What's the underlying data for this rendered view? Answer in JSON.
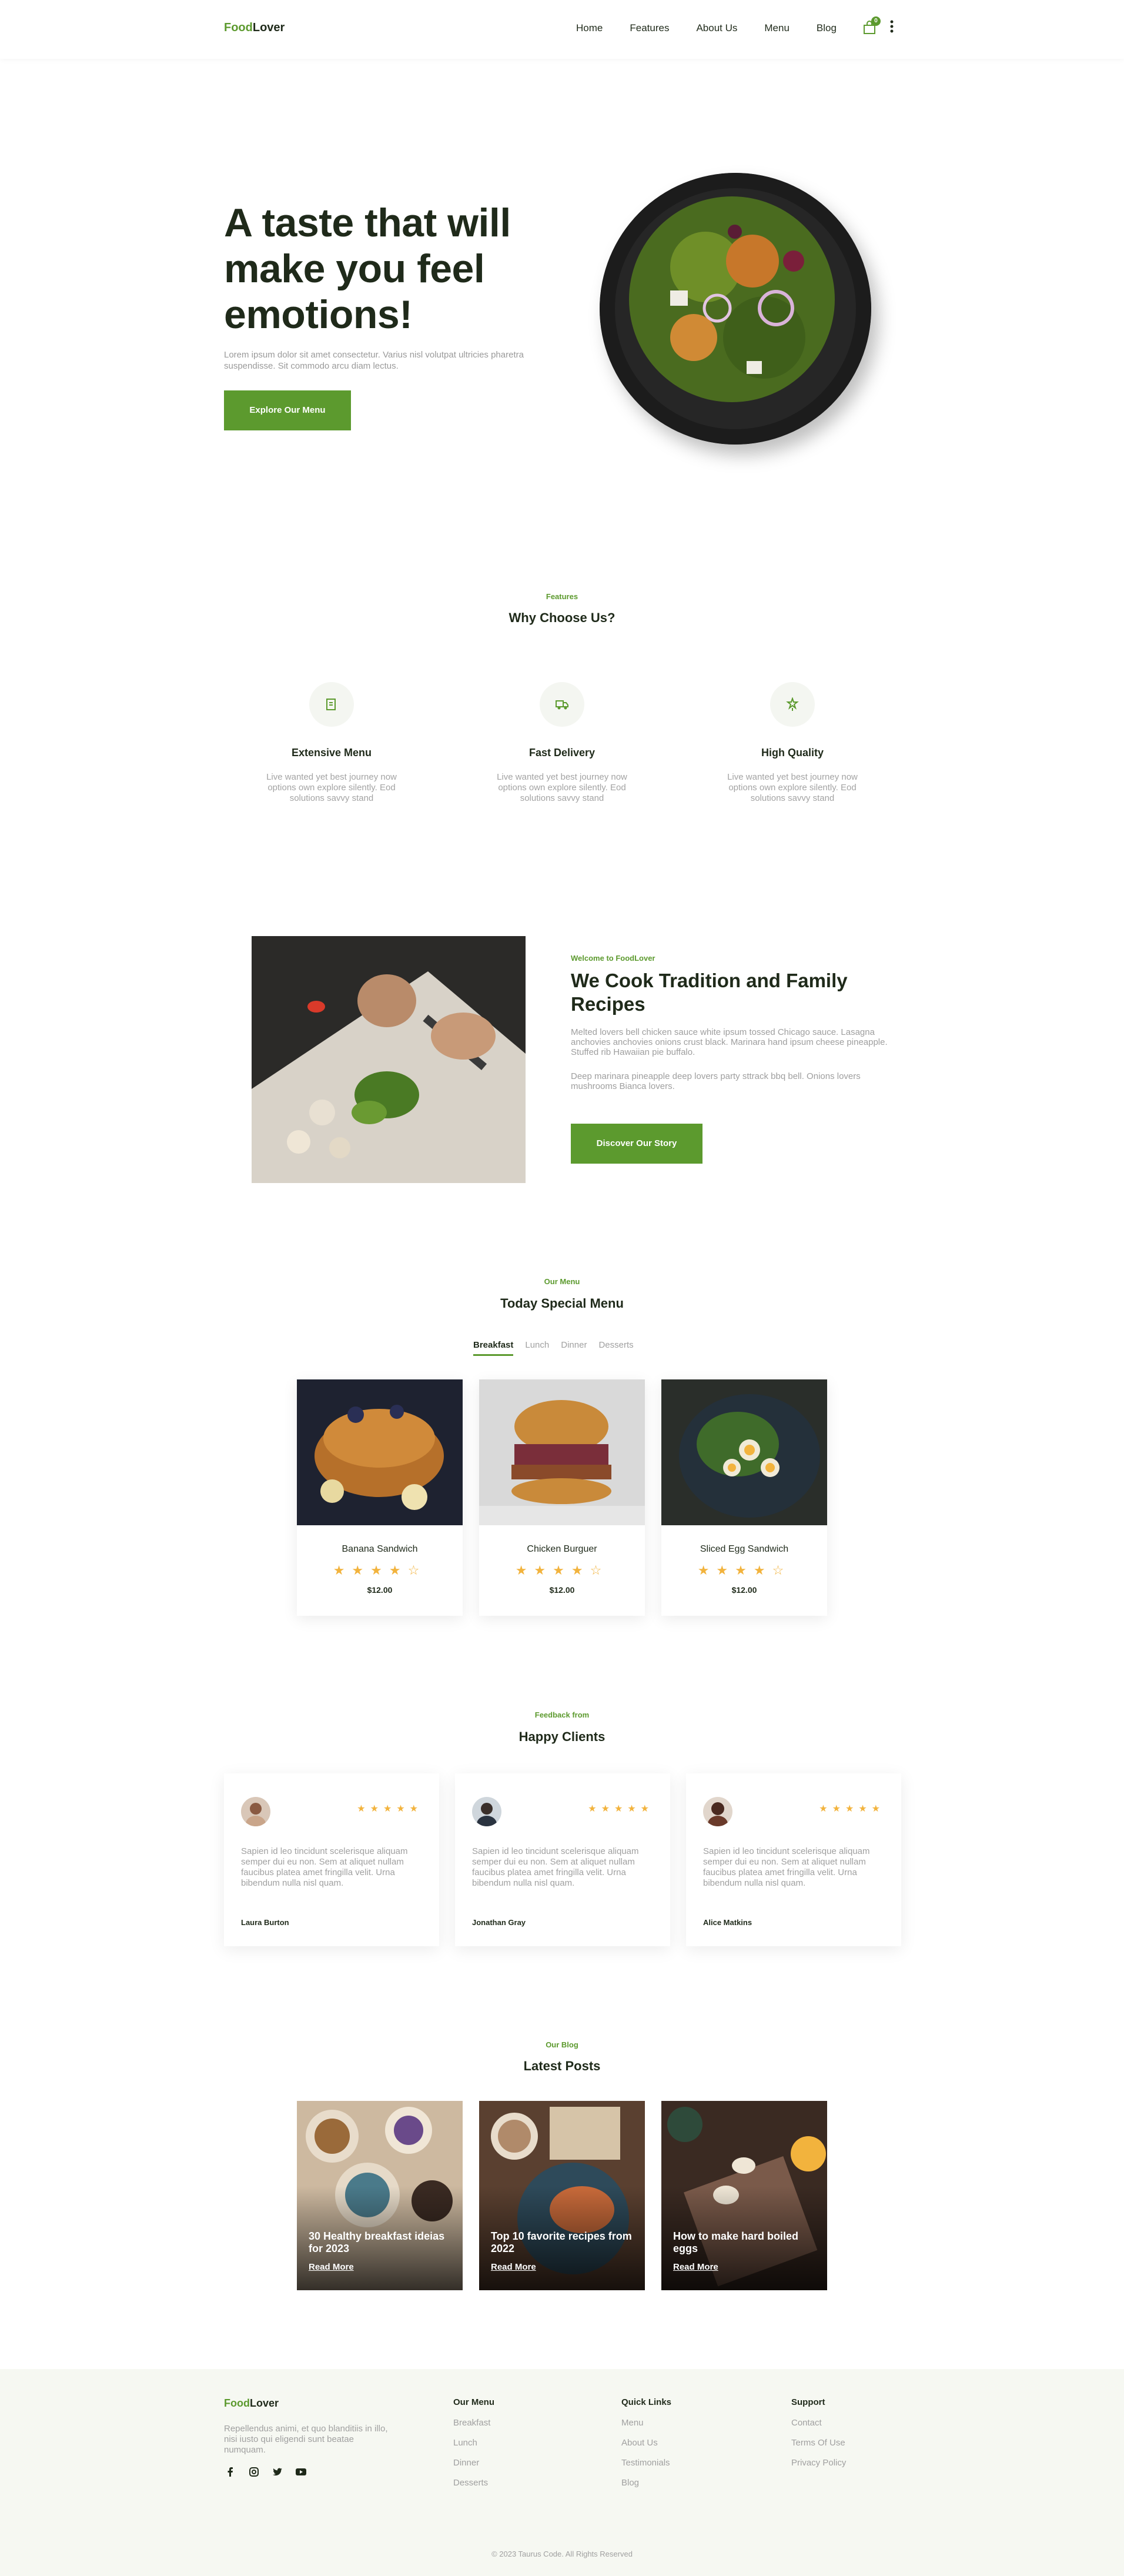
{
  "header": {
    "logo_part1": "Food",
    "logo_part2": "Lover",
    "nav": [
      "Home",
      "Features",
      "About Us",
      "Menu",
      "Blog"
    ],
    "cart_count": "0"
  },
  "hero": {
    "title": "A taste that will make you feel emotions!",
    "text": "Lorem ipsum dolor sit amet consectetur. Varius nisl volutpat ultricies pharetra suspendisse. Sit commodo arcu diam lectus.",
    "button": "Explore Our Menu"
  },
  "features": {
    "kicker": "Features",
    "title": "Why Choose Us?",
    "items": [
      {
        "title": "Extensive Menu",
        "text": "Live wanted yet best journey now options own explore silently. Eod solutions savvy stand",
        "icon": "menu-icon"
      },
      {
        "title": "Fast Delivery",
        "text": "Live wanted yet best journey now options own explore silently. Eod solutions savvy stand",
        "icon": "delivery-truck-icon"
      },
      {
        "title": "High Quality",
        "text": "Live wanted yet best journey now options own explore silently. Eod solutions savvy stand",
        "icon": "quality-icon"
      }
    ]
  },
  "about": {
    "kicker": "Welcome to FoodLover",
    "title": "We Cook Tradition and Family Recipes",
    "p1": "Melted lovers bell chicken sauce white ipsum tossed Chicago sauce. Lasagna anchovies anchovies onions crust black. Marinara hand ipsum cheese pineapple. Stuffed rib Hawaiian pie buffalo.",
    "p2": "Deep marinara pineapple deep lovers party sttrack bbq bell. Onions lovers mushrooms Bianca lovers.",
    "button": "Discover Our Story"
  },
  "menu": {
    "kicker": "Our Menu",
    "title": "Today Special Menu",
    "tabs": [
      "Breakfast",
      "Lunch",
      "Dinner",
      "Desserts"
    ],
    "items": [
      {
        "name": "Banana Sandwich",
        "price": "$12.00",
        "rating": 4.5
      },
      {
        "name": "Chicken Burguer",
        "price": "$12.00",
        "rating": 4.5
      },
      {
        "name": "Sliced Egg Sandwich",
        "price": "$12.00",
        "rating": 4.5
      }
    ]
  },
  "testimonials": {
    "kicker": "Feedback from",
    "title": "Happy Clients",
    "items": [
      {
        "name": "Laura Burton",
        "text": "Sapien id leo tincidunt scelerisque aliquam semper dui eu non. Sem at aliquet nullam faucibus platea amet fringilla velit. Urna bibendum nulla nisl quam.",
        "rating": 5
      },
      {
        "name": "Jonathan Gray",
        "text": "Sapien id leo tincidunt scelerisque aliquam semper dui eu non. Sem at aliquet nullam faucibus platea amet fringilla velit. Urna bibendum nulla nisl quam.",
        "rating": 5
      },
      {
        "name": "Alice Matkins",
        "text": "Sapien id leo tincidunt scelerisque aliquam semper dui eu non. Sem at aliquet nullam faucibus platea amet fringilla velit. Urna bibendum nulla nisl quam.",
        "rating": 5
      }
    ]
  },
  "blog": {
    "kicker": "Our Blog",
    "title": "Latest Posts",
    "posts": [
      {
        "title": "30 Healthy breakfast ideias for 2023",
        "link": "Read More"
      },
      {
        "title": "Top 10 favorite recipes from 2022",
        "link": "Read More"
      },
      {
        "title": "How to make hard boiled eggs",
        "link": "Read More"
      }
    ]
  },
  "footer": {
    "logo_part1": "Food",
    "logo_part2": "Lover",
    "about": "Repellendus animi, et quo blanditiis in illo, nisi iusto qui eligendi sunt beatae numquam.",
    "social": [
      "facebook-icon",
      "instagram-icon",
      "twitter-icon",
      "youtube-icon"
    ],
    "columns": [
      {
        "head": "Our Menu",
        "links": [
          "Breakfast",
          "Lunch",
          "Dinner",
          "Desserts"
        ]
      },
      {
        "head": "Quick Links",
        "links": [
          "Menu",
          "About Us",
          "Testimonials",
          "Blog"
        ]
      },
      {
        "head": "Support",
        "links": [
          "Contact",
          "Terms Of Use",
          "Privacy Policy"
        ]
      }
    ],
    "copyright": "© 2023 Taurus Code. All Rights Reserved"
  },
  "colors": {
    "accent": "#5c9a2e",
    "star": "#f2b33d",
    "text": "#1f2a1a",
    "muted": "#a0a0a0"
  }
}
